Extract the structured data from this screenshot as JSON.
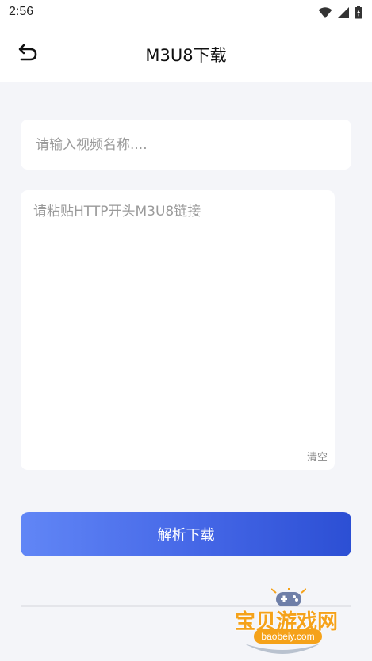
{
  "status_bar": {
    "time": "2:56",
    "icons": [
      "wifi-icon",
      "signal-icon",
      "battery-icon"
    ]
  },
  "header": {
    "back_icon": "back-arrow-icon",
    "title": "M3U8下载"
  },
  "form": {
    "name_placeholder": "请输入视频名称....",
    "name_value": "",
    "url_placeholder": "请粘贴HTTP开头M3U8链接",
    "url_value": "",
    "clear_label": "清空",
    "submit_label": "解析下载"
  },
  "watermark": {
    "text": "宝贝游戏网",
    "url": "baobeiy.com"
  },
  "colors": {
    "accent_start": "#6186f6",
    "accent_end": "#2c4fd4",
    "background": "#f4f5f9",
    "watermark": "#f5a21a"
  }
}
